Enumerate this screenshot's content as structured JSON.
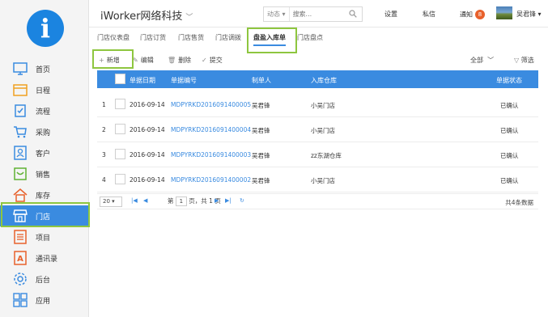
{
  "app": {
    "logo": "i",
    "company": "iWorker网络科技"
  },
  "header": {
    "search_type": "动态",
    "search_placeholder": "搜索...",
    "settings": "设置",
    "messages": "私信",
    "notifications": "通知",
    "notification_count": "8",
    "user": "吴君锋"
  },
  "sidebar": {
    "items": [
      {
        "label": "首页",
        "icon": "monitor-icon"
      },
      {
        "label": "日程",
        "icon": "calendar-icon"
      },
      {
        "label": "流程",
        "icon": "flow-icon"
      },
      {
        "label": "采购",
        "icon": "cart-icon"
      },
      {
        "label": "客户",
        "icon": "customer-icon"
      },
      {
        "label": "销售",
        "icon": "sales-icon"
      },
      {
        "label": "库存",
        "icon": "house-icon"
      },
      {
        "label": "门店",
        "icon": "store-icon",
        "active": true
      },
      {
        "label": "项目",
        "icon": "project-icon"
      },
      {
        "label": "通讯录",
        "icon": "contacts-icon"
      },
      {
        "label": "后台",
        "icon": "gear-icon"
      },
      {
        "label": "应用",
        "icon": "apps-icon"
      }
    ]
  },
  "tabs": [
    {
      "label": "门店仪表盘"
    },
    {
      "label": "门店订货"
    },
    {
      "label": "门店售货"
    },
    {
      "label": "门店调拨"
    },
    {
      "label": "盘盈入库单",
      "active": true
    },
    {
      "label": "门店盘点"
    }
  ],
  "toolbar": {
    "add": "新增",
    "edit": "编辑",
    "delete": "删除",
    "submit": "提交",
    "scope": "全部",
    "filter": "筛选"
  },
  "table": {
    "columns": [
      "单据日期",
      "单据编号",
      "制单人",
      "入库仓库",
      "单据状态"
    ],
    "rows": [
      {
        "no": "1",
        "date": "2016-09-14",
        "code": "MDPYRKD2016091400005",
        "maker": "吴君锋",
        "warehouse": "小吴门店",
        "status": "已确认"
      },
      {
        "no": "2",
        "date": "2016-09-14",
        "code": "MDPYRKD2016091400004",
        "maker": "吴君锋",
        "warehouse": "小吴门店",
        "status": "已确认"
      },
      {
        "no": "3",
        "date": "2016-09-14",
        "code": "MDPYRKD2016091400003",
        "maker": "吴君锋",
        "warehouse": "zz东湖仓库",
        "status": "已确认"
      },
      {
        "no": "4",
        "date": "2016-09-14",
        "code": "MDPYRKD2016091400002",
        "maker": "吴君锋",
        "warehouse": "小吴门店",
        "status": "已确认"
      }
    ]
  },
  "pager": {
    "page_size": "20",
    "page_prefix": "第",
    "page": "1",
    "page_suffix": "页，共 1 页",
    "total": "共4条数据"
  },
  "colors": {
    "accent": "#3a8be0",
    "highlight": "#8ec63f",
    "badge": "#e8612c"
  }
}
